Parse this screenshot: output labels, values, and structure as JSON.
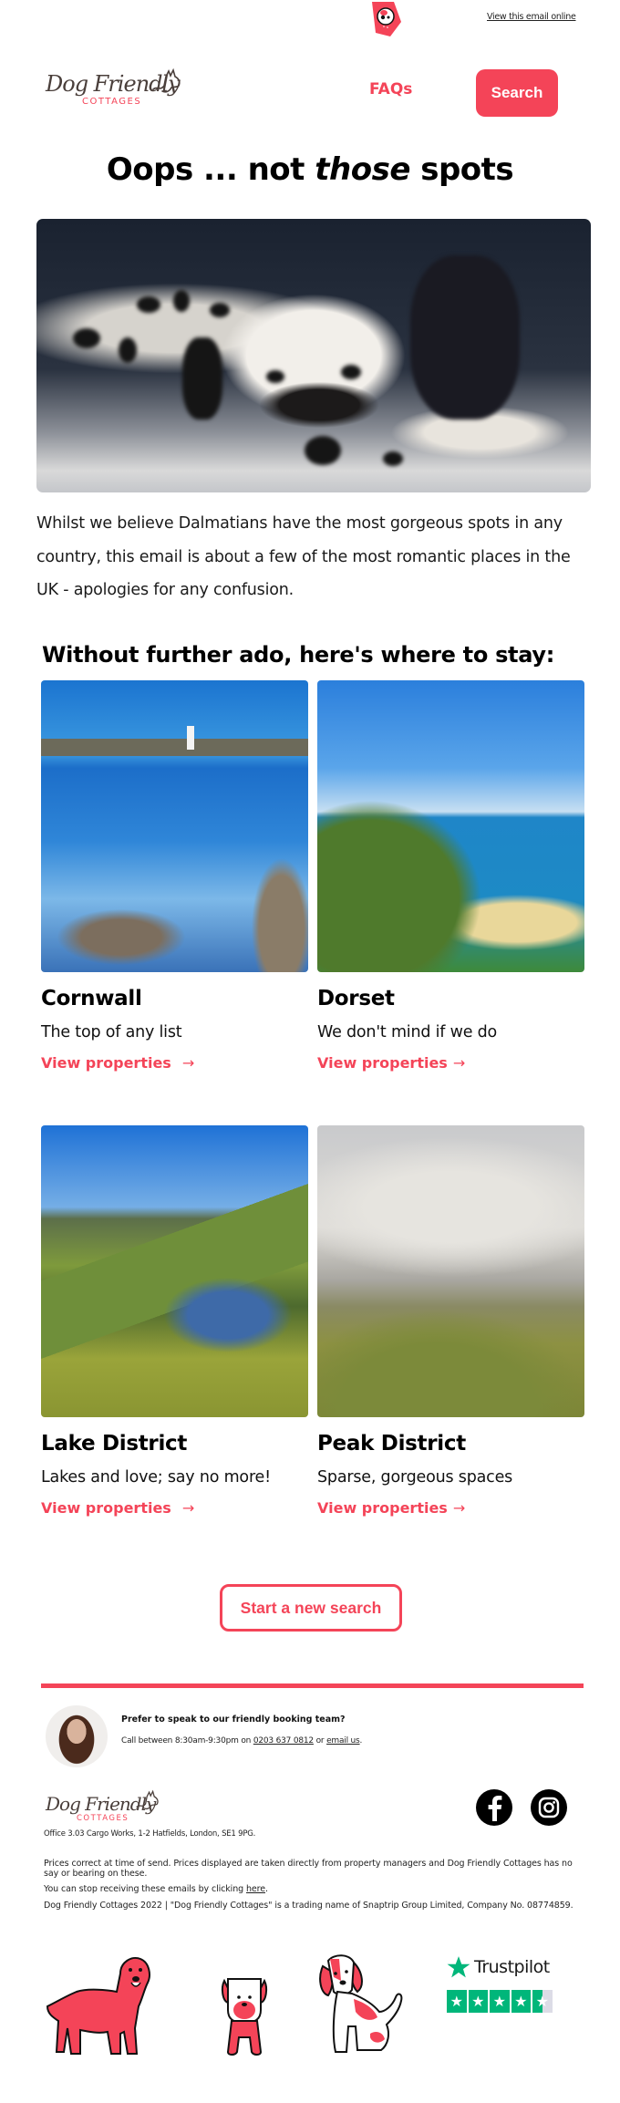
{
  "top_bar": {
    "view_online_label": "View this email online",
    "mascot_icon": "dog-mascot-icon"
  },
  "header": {
    "logo": {
      "main": "Dog Friendly",
      "sub": "COTTAGES"
    },
    "faqs_label": "FAQs",
    "search_label": "Search"
  },
  "hero": {
    "title_part1": "Oops ... not ",
    "title_emphasis": "those",
    "title_part2": " spots",
    "image_alt": "Dalmatian dog lying on carpet",
    "intro": "Whilst we believe Dalmatians have the most gorgeous spots in any country, this email is about a few of the most romantic places in the UK - apologies for any confusion."
  },
  "section": {
    "heading": "Without further ado, here's where to stay:"
  },
  "destinations": [
    {
      "name": "Cornwall",
      "description": "The top of any list",
      "link_label": "View properties",
      "arrow": "→",
      "image_alt": "Lighthouse on island off Cornwall coast"
    },
    {
      "name": "Dorset",
      "description": "We don't mind if we do",
      "link_label": "View properties",
      "arrow": "→",
      "image_alt": "Durdle Door arch and beach"
    },
    {
      "name": "Lake District",
      "description": "Lakes and love; say no more!",
      "link_label": "View properties",
      "arrow": "→",
      "image_alt": "Lake reflecting mountains"
    },
    {
      "name": "Peak District",
      "description": "Sparse, gorgeous spaces",
      "link_label": "View properties",
      "arrow": "→",
      "image_alt": "Grassy hill under cloudy sky"
    }
  ],
  "cta": {
    "new_search_label": "Start a new search"
  },
  "contact": {
    "title": "Prefer to speak to our friendly booking team?",
    "line_prefix": "Call between 8:30am-9:30pm on ",
    "phone": "0203 637 0812",
    "line_middle": " or ",
    "email_label": "email us",
    "line_suffix": "."
  },
  "footer": {
    "logo": {
      "main": "Dog Friendly",
      "sub": "COTTAGES"
    },
    "address": "Office 3.03 Cargo Works, 1-2 Hatfields, London, SE1 9PG.",
    "prices_note": "Prices correct at time of send. Prices displayed are taken directly from property managers and Dog Friendly Cottages has no say or bearing on these.",
    "unsubscribe_prefix": "You can stop receiving these emails by clicking ",
    "unsubscribe_link": "here",
    "unsubscribe_suffix": ".",
    "company_note": "Dog Friendly Cottages 2022 | \"Dog Friendly Cottages\" is a trading name of Snaptrip Group Limited, Company No. 08774859.",
    "social": [
      "facebook",
      "instagram"
    ],
    "trustpilot": {
      "label": "Trustpilot",
      "rating": 4.5,
      "max": 5
    }
  },
  "colors": {
    "brand_red": "#f44458",
    "logo_brown": "#4a3f3b",
    "trustpilot_green": "#00b67a"
  }
}
